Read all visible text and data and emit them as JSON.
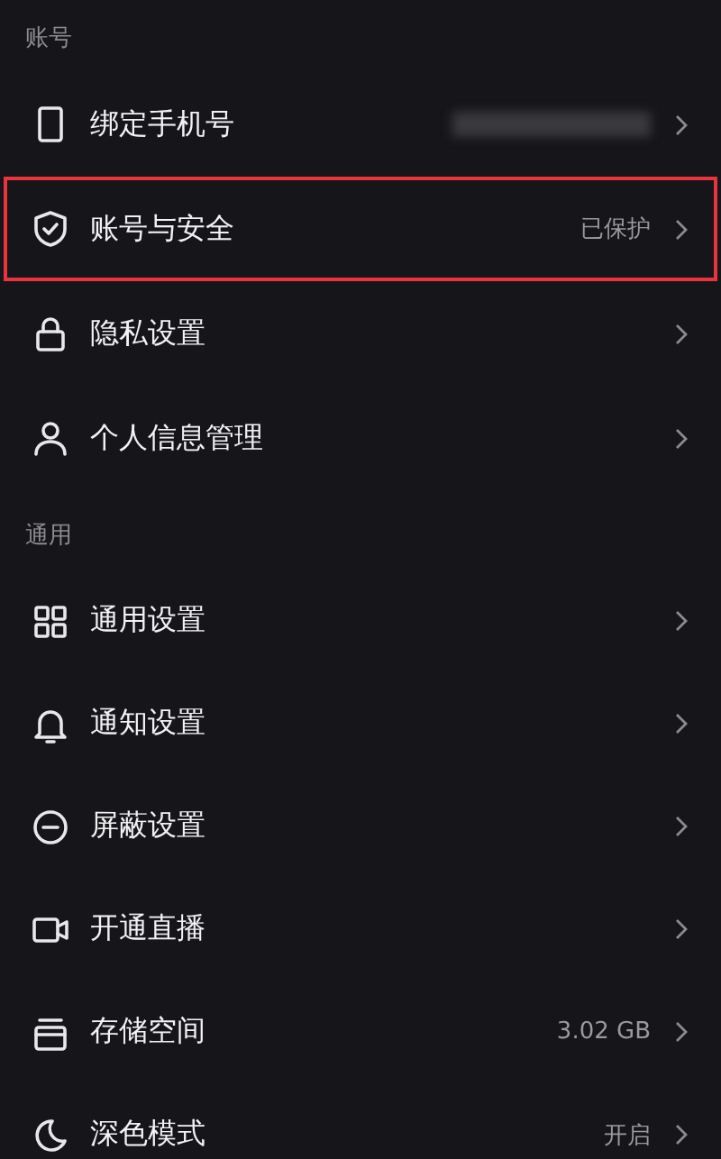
{
  "sections": [
    {
      "title": "账号",
      "items": [
        {
          "label": "绑定手机号",
          "value_blurred": true,
          "highlighted": false
        },
        {
          "label": "账号与安全",
          "value": "已保护",
          "highlighted": true
        },
        {
          "label": "隐私设置",
          "highlighted": false
        },
        {
          "label": "个人信息管理",
          "highlighted": false
        }
      ]
    },
    {
      "title": "通用",
      "items": [
        {
          "label": "通用设置",
          "highlighted": false
        },
        {
          "label": "通知设置",
          "highlighted": false
        },
        {
          "label": "屏蔽设置",
          "highlighted": false
        },
        {
          "label": "开通直播",
          "highlighted": false
        },
        {
          "label": "存储空间",
          "value": "3.02 GB",
          "highlighted": false
        },
        {
          "label": "深色模式",
          "value": "开启",
          "highlighted": false
        }
      ]
    }
  ]
}
